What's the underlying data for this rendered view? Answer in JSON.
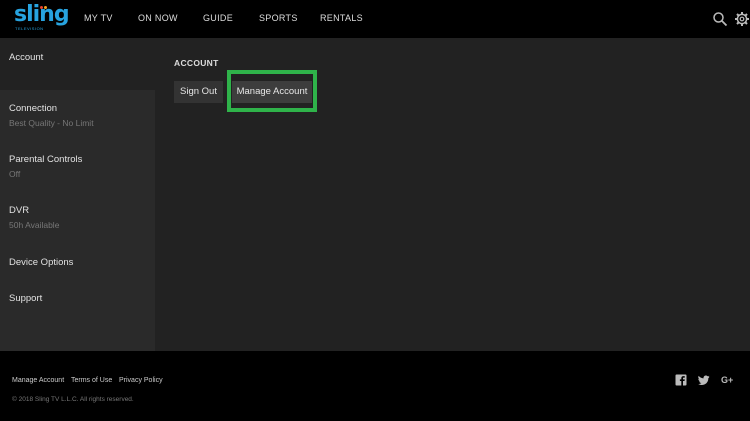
{
  "brand": {
    "logo_text": "sling",
    "logo_tagline": "TELEVISION",
    "colors": {
      "accent": "#27a3df",
      "highlight": "#2fb34a",
      "dot_red": "#e8432e",
      "dot_orange": "#f5a21d"
    }
  },
  "nav": {
    "items": [
      {
        "label": "MY TV"
      },
      {
        "label": "ON NOW"
      },
      {
        "label": "GUIDE"
      },
      {
        "label": "SPORTS"
      },
      {
        "label": "RENTALS"
      }
    ],
    "icons": [
      "search-icon",
      "gear-icon"
    ]
  },
  "sidebar": {
    "items": [
      {
        "label": "Account",
        "sub": ""
      },
      {
        "label": "Connection",
        "sub": "Best Quality - No Limit"
      },
      {
        "label": "Parental Controls",
        "sub": "Off"
      },
      {
        "label": "DVR",
        "sub": "50h Available"
      },
      {
        "label": "Device Options",
        "sub": ""
      },
      {
        "label": "Support",
        "sub": ""
      }
    ],
    "active_index": 0
  },
  "main": {
    "section_title": "ACCOUNT",
    "buttons": {
      "sign_out": "Sign Out",
      "manage_account": "Manage Account"
    }
  },
  "footer": {
    "links": [
      {
        "label": "Manage Account"
      },
      {
        "label": "Terms of Use"
      },
      {
        "label": "Privacy Policy"
      }
    ],
    "copyright": "© 2018 Sling TV L.L.C. All rights reserved.",
    "social_icons": [
      "facebook-icon",
      "twitter-icon",
      "google-plus-icon"
    ],
    "google_plus_text": "G+"
  }
}
